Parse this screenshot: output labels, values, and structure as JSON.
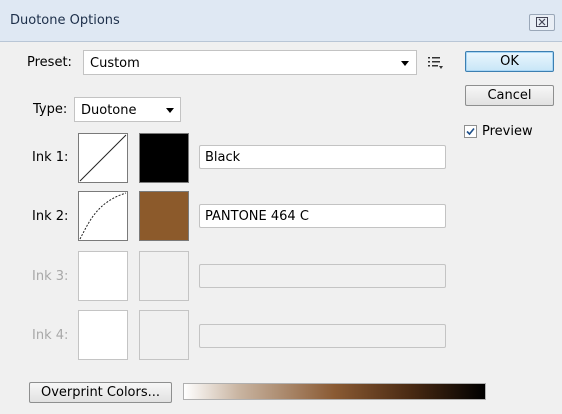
{
  "dialog": {
    "title": "Duotone Options",
    "close_label": "☒"
  },
  "preset": {
    "label": "Preset:",
    "value": "Custom"
  },
  "type": {
    "label": "Type:",
    "value": "Duotone"
  },
  "buttons": {
    "ok": "OK",
    "cancel": "Cancel",
    "overprint": "Overprint Colors..."
  },
  "preview": {
    "label": "Preview",
    "checked": true
  },
  "inks": [
    {
      "label": "Ink 1:",
      "name": "Black",
      "color": "#000000",
      "enabled": true
    },
    {
      "label": "Ink 2:",
      "name": "PANTONE 464 C",
      "color": "#8c5a2b",
      "enabled": true
    },
    {
      "label": "Ink 3:",
      "name": "",
      "color": "",
      "enabled": false
    },
    {
      "label": "Ink 4:",
      "name": "",
      "color": "",
      "enabled": false
    }
  ]
}
